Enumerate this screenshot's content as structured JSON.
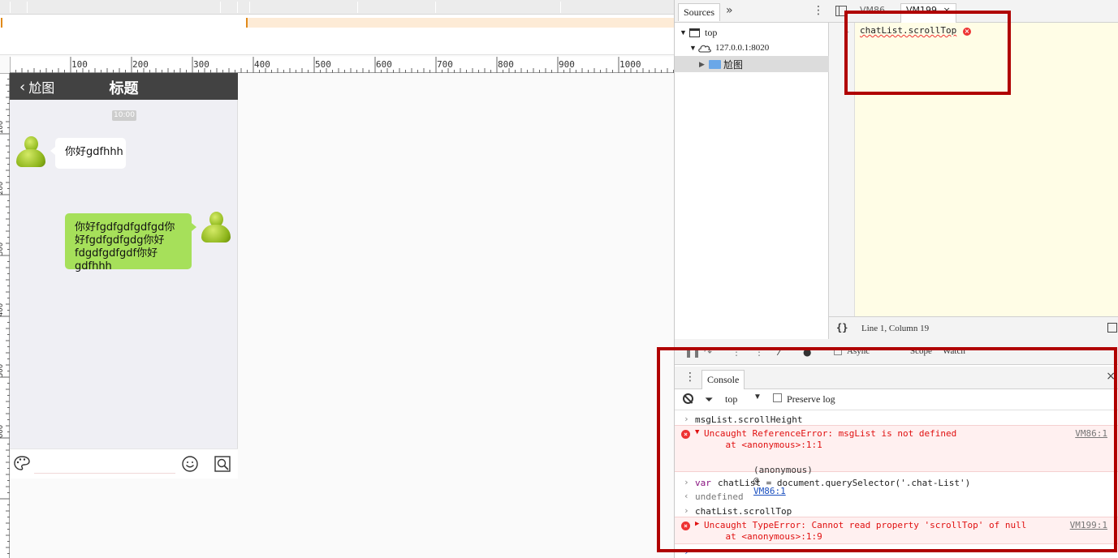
{
  "ruler": {
    "h_labels": [
      "100",
      "200",
      "300",
      "400",
      "500",
      "600",
      "700",
      "800",
      "900",
      "1000"
    ],
    "v_labels": [
      "100",
      "200",
      "300",
      "400",
      "500",
      "600"
    ]
  },
  "phone": {
    "back_label": "尬图",
    "title": "标题",
    "time": "10:00",
    "msg_left": "你好gdfhhh",
    "msg_right": "你好fgdfgdfgdfgd你好fgdfgdfgdg你好fdgdfgdfgdf你好gdfhhh",
    "input_placeholder": ""
  },
  "devtools": {
    "nav": {
      "tab_label": "Sources",
      "more": "»",
      "tree": [
        {
          "label": "top",
          "arrow": "▼"
        },
        {
          "label": "127.0.0.1:8020",
          "arrow": "▼"
        },
        {
          "label": "尬图",
          "arrow": "▶"
        }
      ]
    },
    "editor": {
      "tabs": [
        "VM86",
        "VM199"
      ],
      "tab_close": "×",
      "line_number": "1",
      "code": "chatList.scrollTop"
    },
    "status": {
      "pretty_print": "{}",
      "cursor": "Line 1, Column 19"
    },
    "debug": {
      "async_label": "Async",
      "scope_label": "Scope",
      "watch_label": "Watch"
    },
    "console": {
      "tab_label": "Console",
      "close": "×",
      "context": "top",
      "preserve_log": "Preserve log",
      "lines": {
        "l1": "msgList.scrollHeight",
        "l2_err": "Uncaught ReferenceError: msgList is not defined",
        "l2_at": "    at <anonymous>:1:1",
        "l2_src": "VM86:1",
        "l3_anon": "(anonymous)",
        "l3_at": "@",
        "l3_link": "VM86:1",
        "l4_prefix": "var",
        "l4": "chatList = document.querySelector('.chat-List')",
        "l5": "undefined",
        "l6": "chatList.scrollTop",
        "l7_err": "Uncaught TypeError: Cannot read property 'scrollTop' of null",
        "l7_at": "    at <anonymous>:1:9",
        "l7_src": "VM199:1"
      }
    }
  },
  "colors": {
    "header_bg": "#424242",
    "bubble_green": "#a6e05a",
    "error_red": "#e01010",
    "highlight_red": "#b00000"
  }
}
